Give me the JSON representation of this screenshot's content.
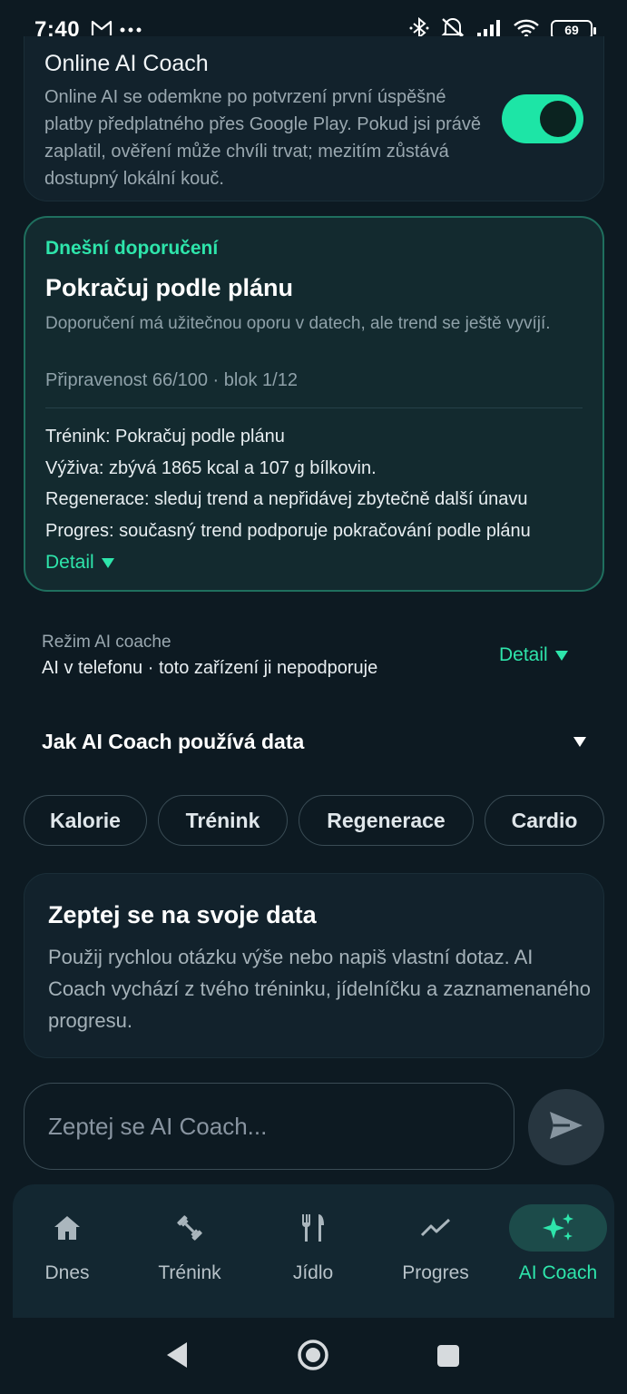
{
  "status_bar": {
    "time": "7:40",
    "left_icons": [
      "gmail-icon",
      "more-dots-icon"
    ],
    "right_icons": [
      "bluetooth-icon",
      "mute-icon",
      "signal-icon",
      "wifi-icon"
    ],
    "battery": "69"
  },
  "online_coach": {
    "title": "Online AI Coach",
    "description": "Online AI se odemkne po potvrzení první úspěšné platby předplatného přes Google Play. Pokud jsi právě zaplatil, ověření může chvíli trvat; mezitím zůstává dostupný lokální kouč.",
    "toggle_on": true
  },
  "recommendation": {
    "kicker": "Dnešní doporučení",
    "title": "Pokračuj podle plánu",
    "description": "Doporučení má užitečnou oporu v datech, ale trend se ještě vyvíjí.",
    "meta": "Připravenost 66/100 · blok 1/12",
    "lines": [
      "Trénink: Pokračuj podle plánu",
      "Výživa: zbývá 1865 kcal a 107 g bílkovin.",
      "Regenerace: sleduj trend a nepřidávej zbytečně další únavu",
      "Progres: současný trend podporuje pokračování podle plánu"
    ],
    "detail_label": "Detail"
  },
  "mode": {
    "label": "Režim AI coache",
    "value": "AI v telefonu · toto zařízení ji nepodporuje",
    "detail_label": "Detail"
  },
  "data_usage": {
    "label": "Jak AI Coach používá data"
  },
  "chips": [
    "Kalorie",
    "Trénink",
    "Regenerace",
    "Cardio"
  ],
  "ask_card": {
    "title": "Zeptej se na svoje data",
    "description": "Použij rychlou otázku výše nebo napiš vlastní dotaz. AI Coach vychází z tvého tréninku, jídelníčku a zaznamenaného progresu."
  },
  "input": {
    "placeholder": "Zeptej se AI Coach...",
    "value": ""
  },
  "bottom_nav": {
    "items": [
      {
        "label": "Dnes",
        "icon": "home-icon"
      },
      {
        "label": "Trénink",
        "icon": "dumbbell-icon"
      },
      {
        "label": "Jídlo",
        "icon": "fork-knife-icon"
      },
      {
        "label": "Progres",
        "icon": "trend-icon"
      },
      {
        "label": "AI Coach",
        "icon": "sparkles-icon"
      }
    ],
    "active": "AI Coach"
  },
  "colors": {
    "accent": "#2ee5ab",
    "toggle": "#1de5a6",
    "background": "#0d1a22",
    "card": "#12222c"
  }
}
